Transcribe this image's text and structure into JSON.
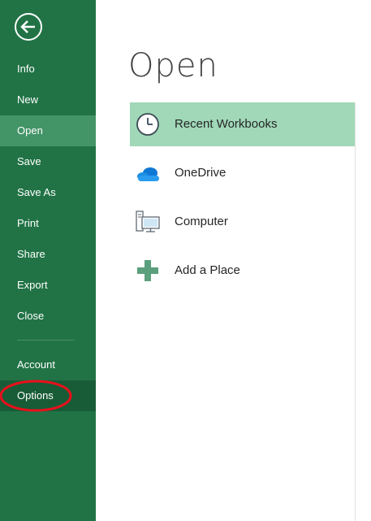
{
  "sidebar": {
    "back_label": "Back",
    "items": [
      {
        "label": "Info"
      },
      {
        "label": "New"
      },
      {
        "label": "Open"
      },
      {
        "label": "Save"
      },
      {
        "label": "Save As"
      },
      {
        "label": "Print"
      },
      {
        "label": "Share"
      },
      {
        "label": "Export"
      },
      {
        "label": "Close"
      },
      {
        "label": "Account"
      },
      {
        "label": "Options"
      }
    ],
    "selected_item": "Open",
    "highlighted_item": "Options"
  },
  "main": {
    "title": "Open",
    "places": [
      {
        "label": "Recent Workbooks",
        "icon": "clock-icon"
      },
      {
        "label": "OneDrive",
        "icon": "cloud-icon"
      },
      {
        "label": "Computer",
        "icon": "computer-icon"
      },
      {
        "label": "Add a Place",
        "icon": "plus-icon"
      }
    ],
    "selected_place": "Recent Workbooks"
  },
  "colors": {
    "sidebar_bg": "#217346",
    "sidebar_selected": "#439467",
    "place_selected": "#a0d8b8",
    "annotation": "#e8101c"
  }
}
